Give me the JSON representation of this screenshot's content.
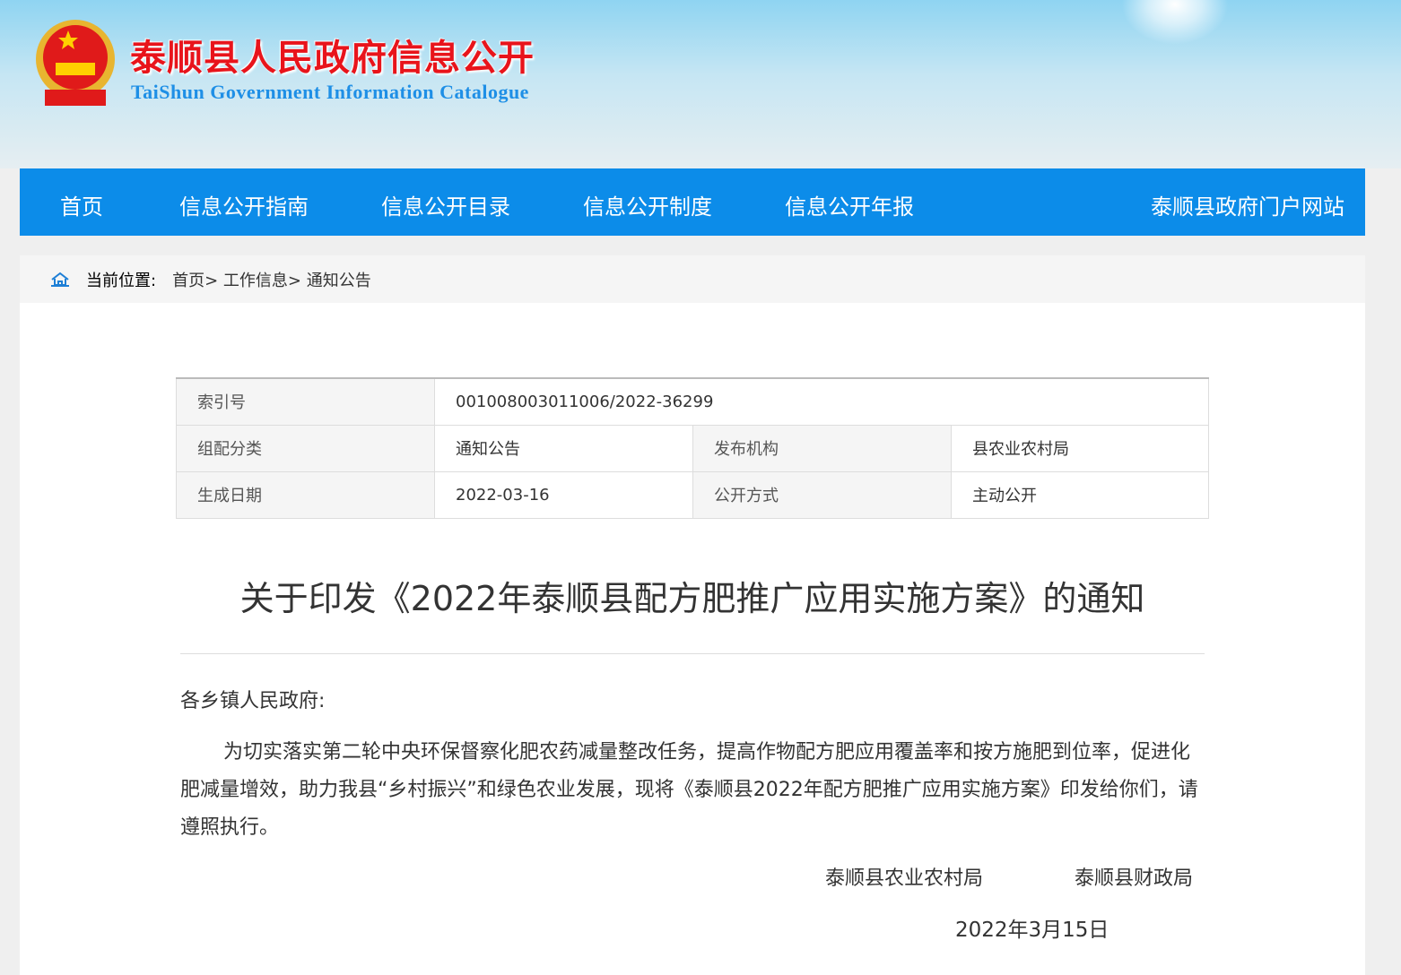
{
  "header": {
    "title": "泰顺县人民政府信息公开",
    "subtitle": "TaiShun Government Information Catalogue"
  },
  "nav": {
    "items": [
      "首页",
      "信息公开指南",
      "信息公开目录",
      "信息公开制度",
      "信息公开年报"
    ],
    "portal": "泰顺县政府门户网站"
  },
  "breadcrumb": {
    "label": "当前位置:",
    "items": [
      "首页>",
      "工作信息>",
      "通知公告"
    ]
  },
  "meta": {
    "index_label": "索引号",
    "index_value": "001008003011006/2022-36299",
    "category_label": "组配分类",
    "category_value": "通知公告",
    "publisher_label": "发布机构",
    "publisher_value": "县农业农村局",
    "date_label": "生成日期",
    "date_value": "2022-03-16",
    "mode_label": "公开方式",
    "mode_value": "主动公开"
  },
  "article": {
    "title": "关于印发《2022年泰顺县配方肥推广应用实施方案》的通知",
    "salutation": "各乡镇人民政府:",
    "paragraph": "为切实落实第二轮中央环保督察化肥农药减量整改任务，提高作物配方肥应用覆盖率和按方施肥到位率，促进化肥减量增效，助力我县“乡村振兴”和绿色农业发展，现将《泰顺县2022年配方肥推广应用实施方案》印发给你们，请遵照执行。",
    "signer1": "泰顺县农业农村局",
    "signer2": "泰顺县财政局",
    "date": "2022年3月15日"
  }
}
